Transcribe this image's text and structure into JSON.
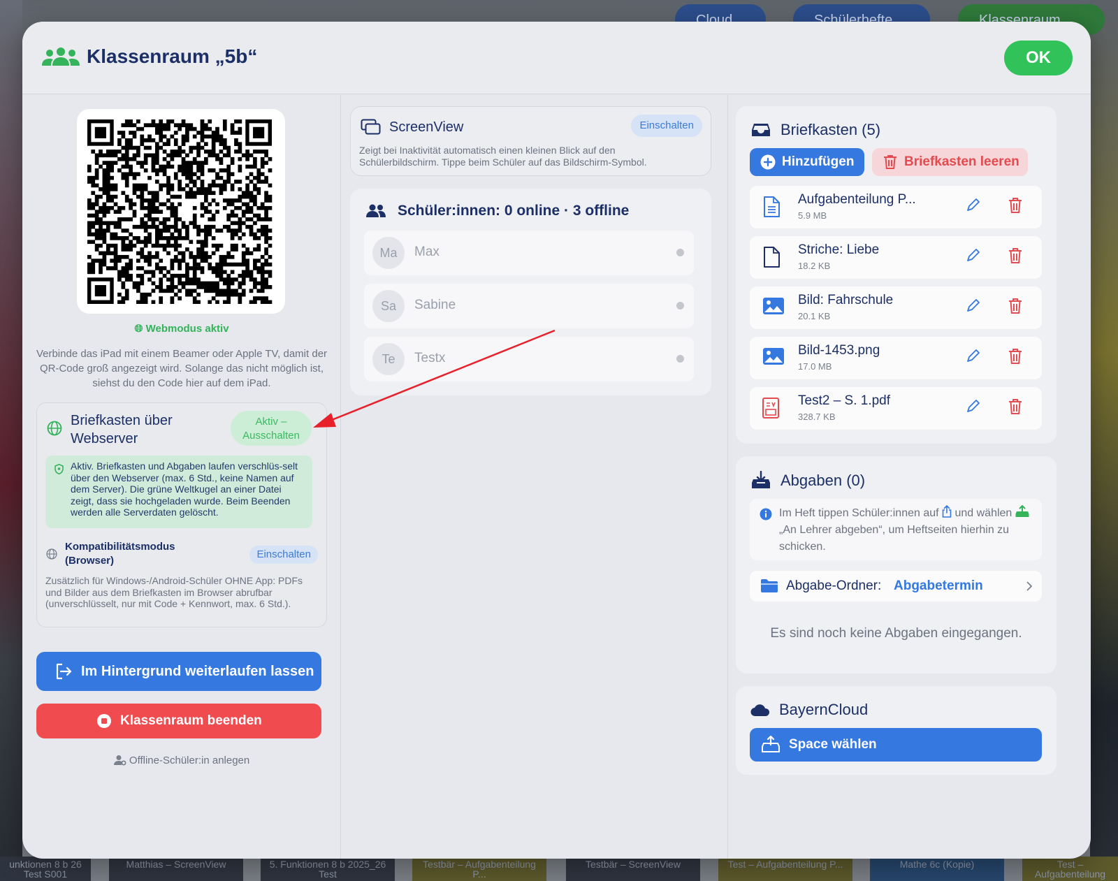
{
  "background": {
    "top_pills": [
      "Cloud",
      "Schülerhefte",
      "Klassenraum"
    ],
    "bottom_tiles": [
      "unktionen 8 b 26 Test S001",
      "Matthias – ScreenView",
      "5. Funktionen 8 b 2025_26 Test",
      "Testbär – Aufgabenteilung P...",
      "Testbär – ScreenView",
      "Test – Aufgabenteilung P...",
      "Mathe 6c (Kopie)",
      "Test – Aufgabenteilung"
    ]
  },
  "modal": {
    "title": "Klassenraum „5b“",
    "ok_label": "OK"
  },
  "left": {
    "webmode": "Webmodus aktiv",
    "hint": "Verbinde das iPad mit einem Beamer oder Apple TV, damit der QR-Code groß angezeigt wird. Solange das nicht möglich ist, siehst du den Code hier auf dem iPad.",
    "webserver": {
      "title": "Briefkasten über Webserver",
      "toggle_label": "Aktiv – Ausschalten",
      "info": "Aktiv. Briefkasten und Abgaben laufen verschlüs-selt über den Webserver (max. 6 Std., keine Namen auf dem Server). Die grüne Weltkugel an einer Datei zeigt, dass sie hochgeladen wurde. Beim Beenden werden alle Serverdaten gelöscht.",
      "compat_title": "Kompatibilitätsmodus (Browser)",
      "compat_toggle": "Einschalten",
      "compat_text": "Zusätzlich für Windows-/Android-Schüler OHNE App: PDFs und Bilder aus dem Briefkasten im Browser abrufbar (unverschlüsselt, nur mit Code + Kennwort, max. 6 Std.)."
    },
    "background_button": "Im Hintergrund weiterlaufen lassen",
    "end_button": "Klassenraum beenden",
    "offline_student": "Offline-Schüler:in anlegen"
  },
  "middle": {
    "screenview": {
      "title": "ScreenView",
      "toggle": "Einschalten",
      "text": "Zeigt bei Inaktivität automatisch einen kleinen Blick auf den Schülerbildschirm. Tippe beim Schüler auf das Bildschirm-Symbol."
    },
    "students": {
      "heading": "Schüler:innen: 0 online · 3 offline",
      "list": [
        {
          "initials": "Ma",
          "name": "Max"
        },
        {
          "initials": "Sa",
          "name": "Sabine"
        },
        {
          "initials": "Te",
          "name": "Testx"
        }
      ]
    }
  },
  "right": {
    "briefkasten": {
      "title": "Briefkasten (5)",
      "add_label": "Hinzufügen",
      "clear_label": "Briefkasten leeren",
      "files": [
        {
          "name": "Aufgabenteilung P...",
          "size": "5.9 MB",
          "icon": "document-lines-icon"
        },
        {
          "name": "Striche: Liebe",
          "size": "18.2 KB",
          "icon": "document-icon"
        },
        {
          "name": "Bild: Fahrschule",
          "size": "20.1 KB",
          "icon": "image-icon"
        },
        {
          "name": "Bild-1453.png",
          "size": "17.0 MB",
          "icon": "image-icon"
        },
        {
          "name": "Test2 – S. 1.pdf",
          "size": "328.7 KB",
          "icon": "pdf-icon"
        }
      ]
    },
    "abgaben": {
      "title": "Abgaben (0)",
      "info_a": "Im Heft tippen Schüler:innen auf",
      "info_b": "und wählen",
      "info_c": "„An Lehrer abgeben“, um Heftseiten hierhin zu schicken.",
      "folder_label": "Abgabe-Ordner:",
      "folder_value": "Abgabetermin",
      "empty": "Es sind noch keine Abgaben eingegangen."
    },
    "cloud": {
      "title": "BayernCloud",
      "button": "Space wählen"
    }
  },
  "colors": {
    "accent_blue": "#3478e0",
    "ok_green": "#31c25a",
    "danger_red": "#f04b4f",
    "title_navy": "#1c2f66",
    "annotation_arrow": "#e8202a"
  }
}
